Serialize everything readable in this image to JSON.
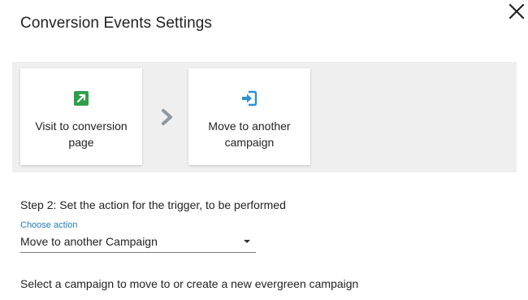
{
  "dialog": {
    "title": "Conversion Events Settings",
    "close_icon": "close-icon"
  },
  "trigger_flow": {
    "trigger_card": {
      "icon": "external-link-icon",
      "icon_color": "#2e9e4a",
      "label": "Visit to conversion page"
    },
    "arrow_icon": "chevron-right-icon",
    "action_card": {
      "icon": "sign-in-icon",
      "icon_color": "#2b8fd6",
      "label": "Move to another campaign"
    }
  },
  "step": {
    "text": "Step 2: Set the action for the trigger, to be performed",
    "field_label": "Choose action",
    "selected_value": "Move to another Campaign"
  },
  "hint": "Select a campaign to move to or create a new evergreen campaign",
  "colors": {
    "accent": "#1a7fb8",
    "panel_bg": "#efefef"
  }
}
